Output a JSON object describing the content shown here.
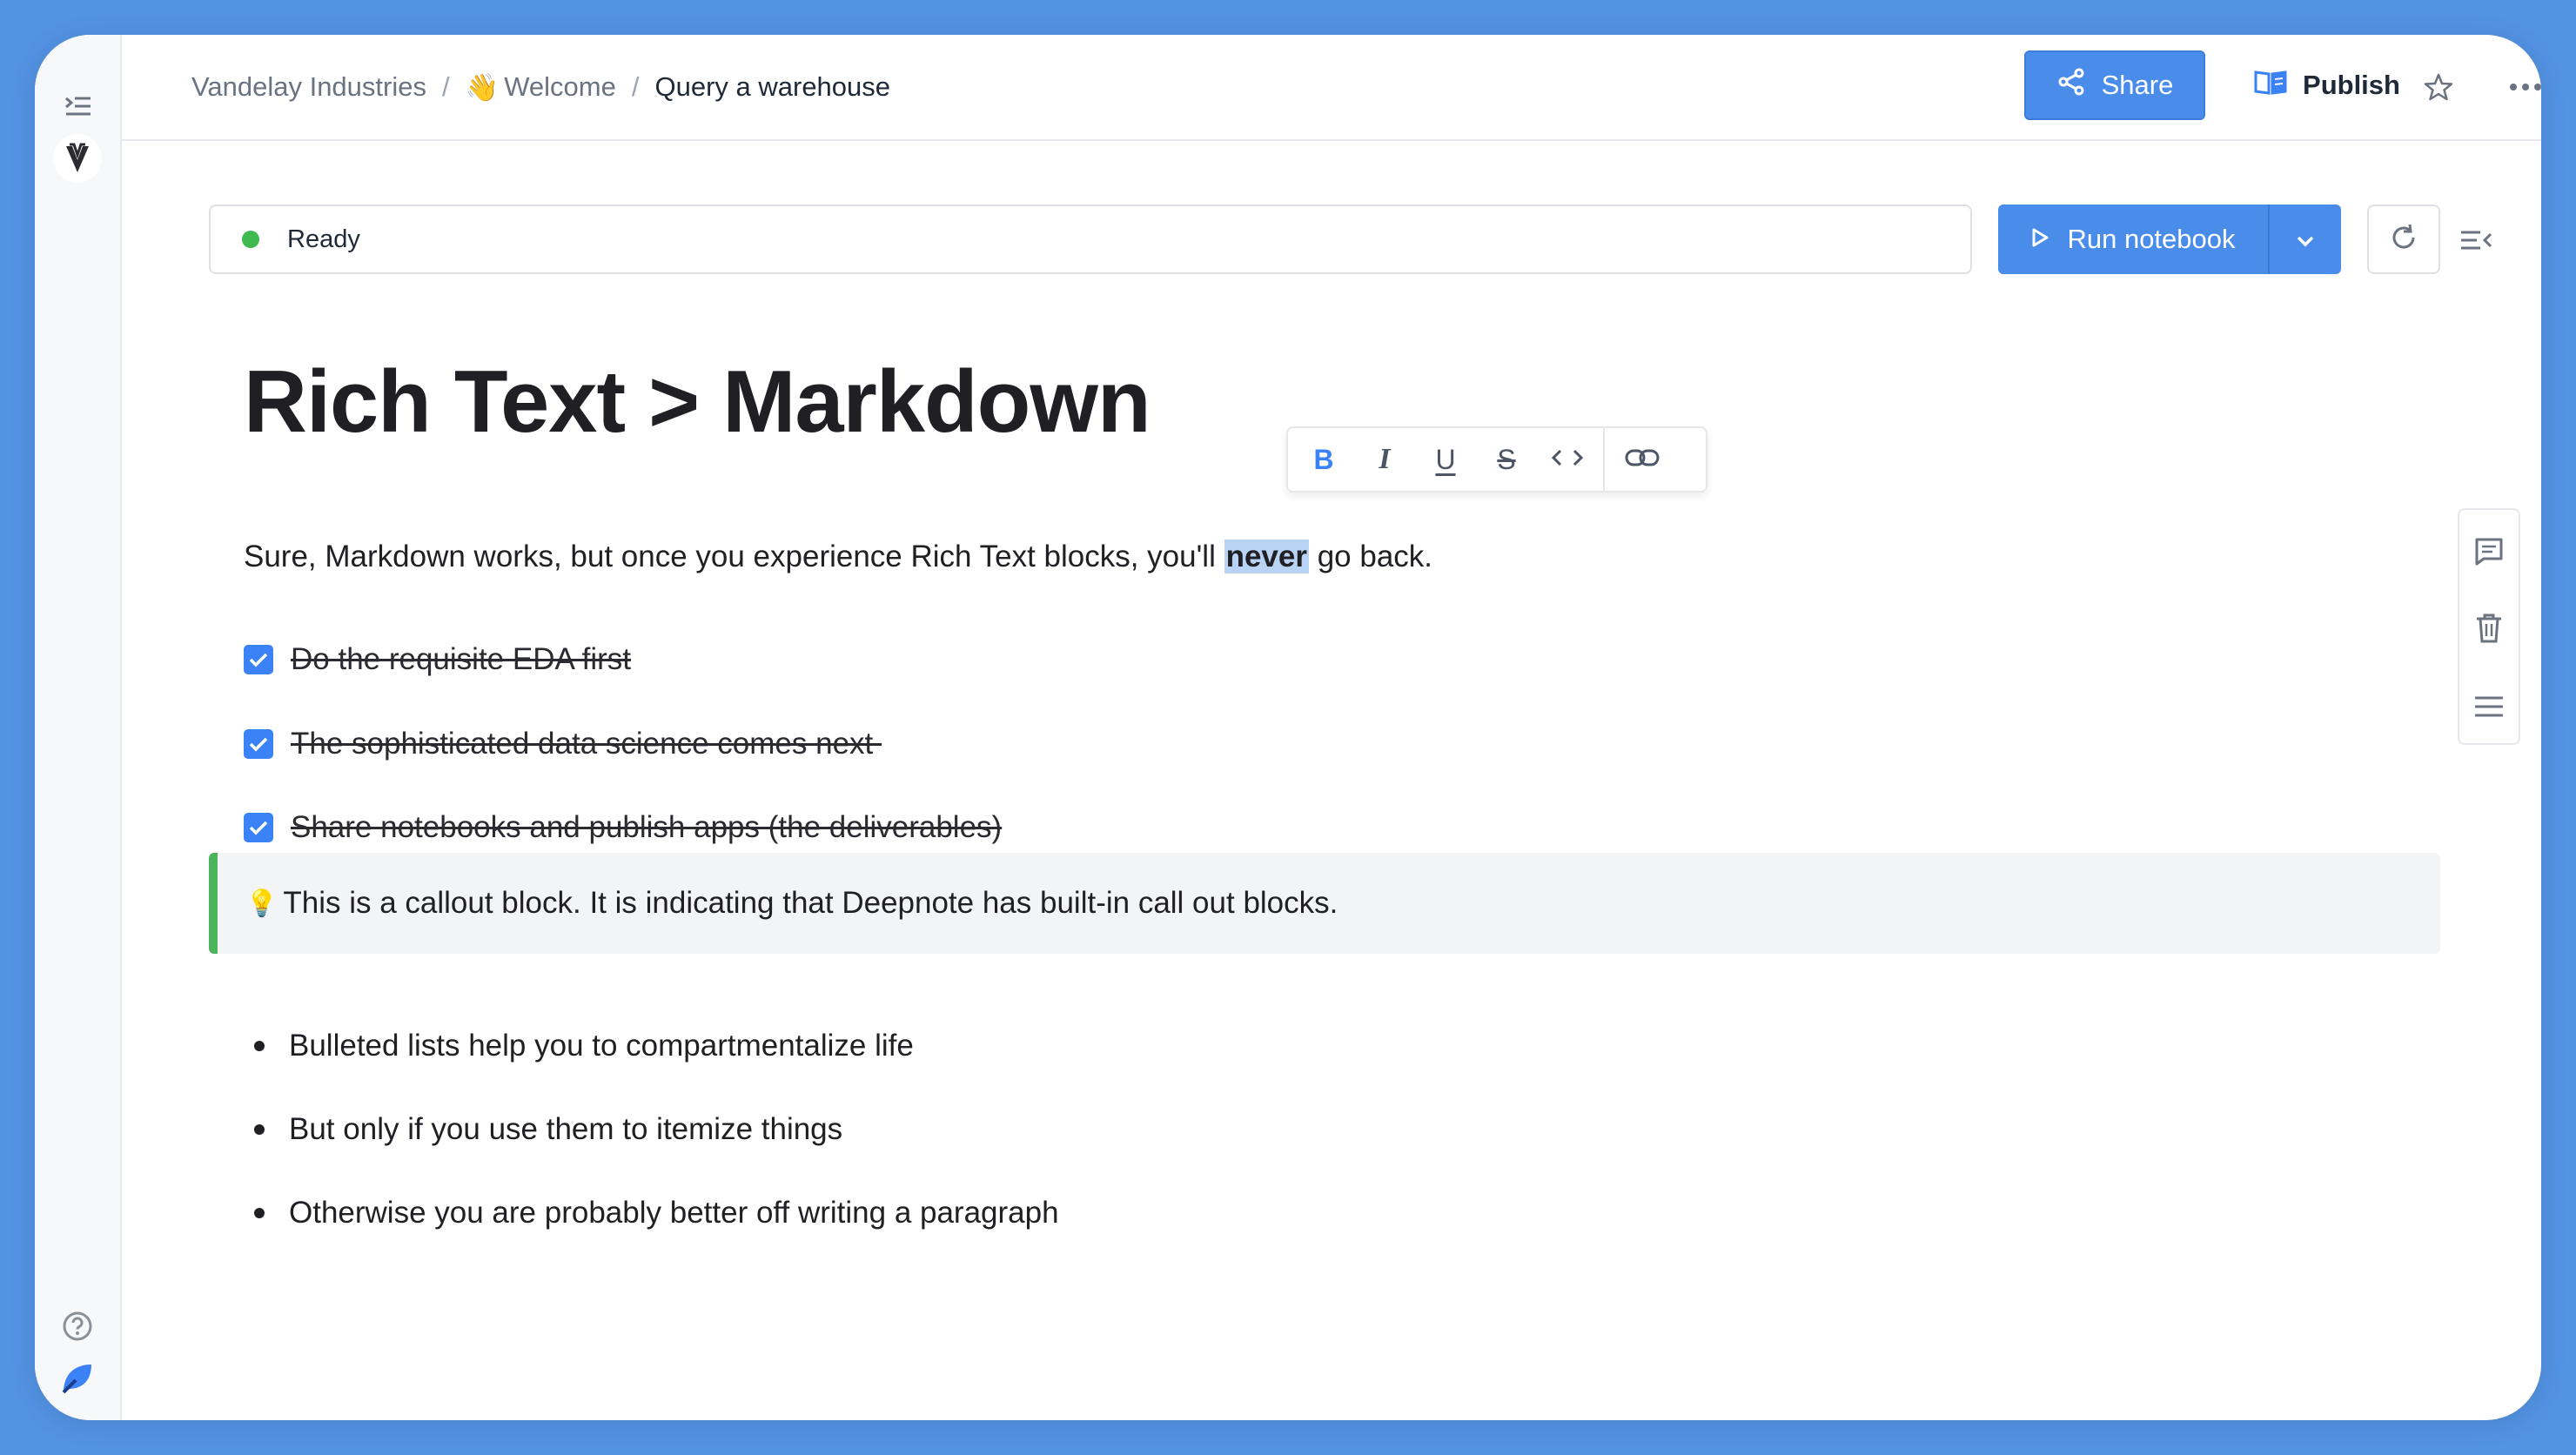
{
  "breadcrumb": {
    "workspace": "Vandelay Industries",
    "separator": "/",
    "folder_emoji": "👋",
    "folder": "Welcome",
    "notebook": "Query a warehouse"
  },
  "header": {
    "share_label": "Share",
    "publish_label": "Publish"
  },
  "status": {
    "text": "Ready",
    "color": "#3fb950"
  },
  "run": {
    "label": "Run notebook"
  },
  "content": {
    "title": "Rich Text > Markdown",
    "paragraph_before": "Sure, Markdown works, but once you experience Rich Text blocks, you'll ",
    "paragraph_highlight": "never",
    "paragraph_after": " go back.",
    "todos": [
      "Do the requisite EDA first",
      "The sophisticated data science comes next ",
      "Share notebooks and publish apps (the deliverables)"
    ],
    "callout": {
      "emoji": "💡",
      "text": "This is a callout block. It is indicating that Deepnote has built-in call out blocks."
    },
    "bullets": [
      "Bulleted lists help you to compartmentalize life",
      "But only if you use them to itemize things",
      "Otherwise you are probably better off writing a paragraph"
    ]
  },
  "format_toolbar": {
    "bold": "B",
    "italic": "I",
    "underline": "U",
    "strikethrough": "S"
  },
  "colors": {
    "accent": "#4a8cea",
    "callout_border": "#4cb25c",
    "highlight": "#b9d3f5"
  },
  "icons": [
    "sidebar-toggle-icon",
    "workspace-logo-icon",
    "help-icon",
    "deepnote-logo-icon",
    "share-icon",
    "book-icon",
    "star-icon",
    "more-icon",
    "play-icon",
    "chevron-down-icon",
    "refresh-icon",
    "collapse-icon",
    "comment-icon",
    "trash-icon",
    "drag-handle-icon",
    "link-icon",
    "code-icon"
  ]
}
